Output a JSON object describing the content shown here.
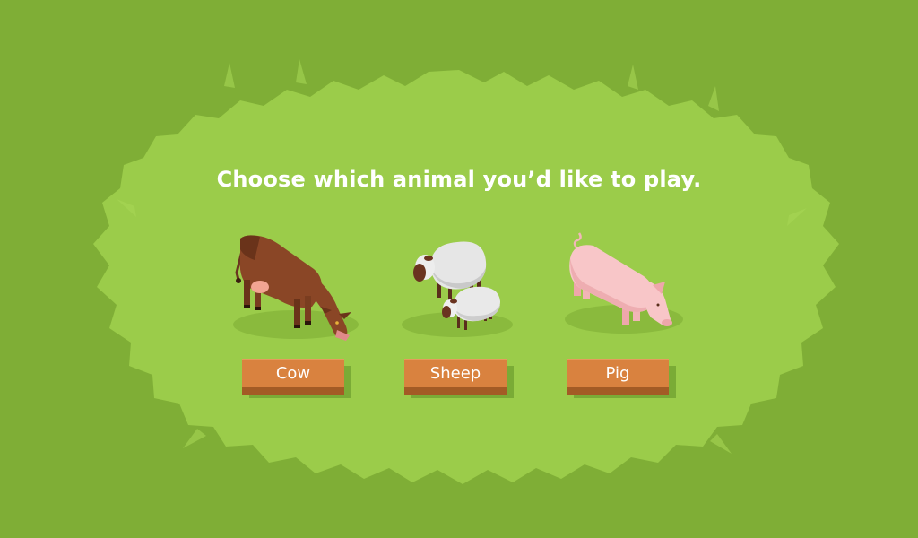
{
  "screen": {
    "prompt": "Choose which animal you’d like to play."
  },
  "choices": [
    {
      "id": "cow",
      "label": "Cow",
      "icon": "cow-icon"
    },
    {
      "id": "sheep",
      "label": "Sheep",
      "icon": "sheep-icon"
    },
    {
      "id": "pig",
      "label": "Pig",
      "icon": "pig-icon"
    }
  ],
  "colors": {
    "outer_grass": "#7fae36",
    "inner_grass": "#9bcc4a",
    "button_face": "#d9823f",
    "button_side": "#a35b25",
    "text": "#ffffff"
  }
}
